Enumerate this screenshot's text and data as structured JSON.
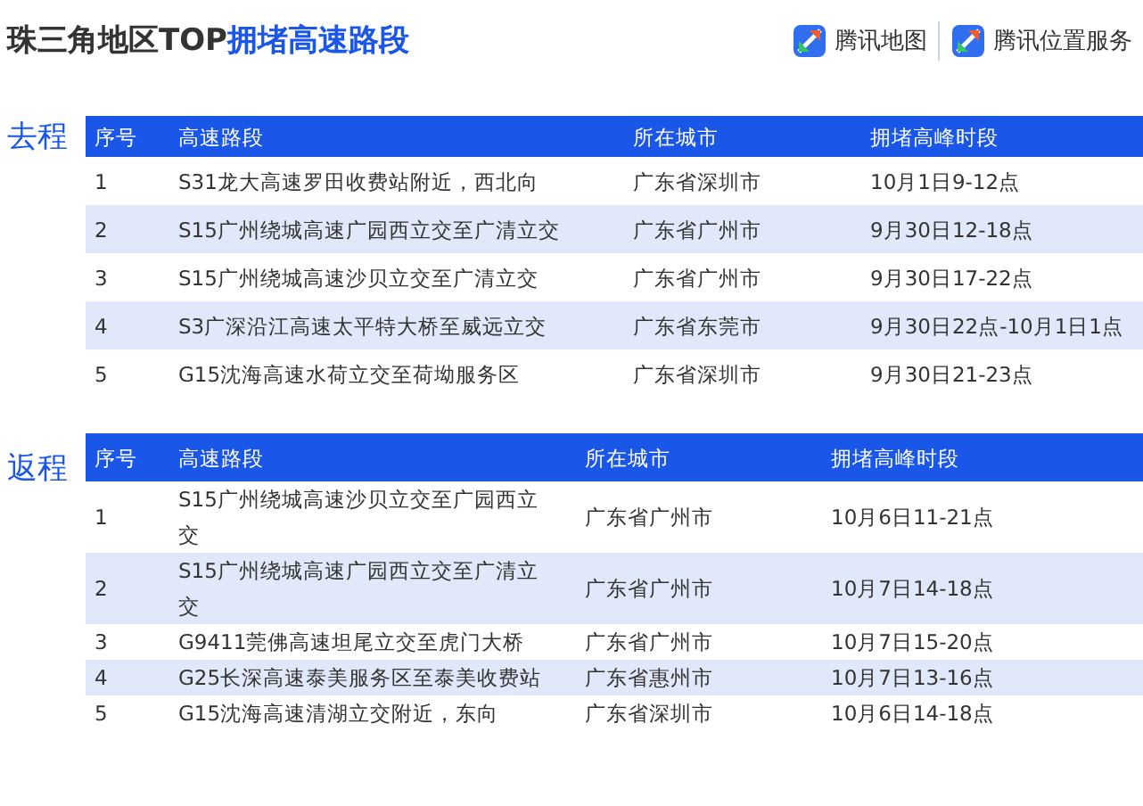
{
  "title": {
    "plain": "珠三角地区TOP",
    "highlight": "拥堵高速路段"
  },
  "brands": [
    {
      "name": "腾讯地图"
    },
    {
      "name": "腾讯位置服务"
    }
  ],
  "sections": [
    {
      "label": "去程",
      "columns": [
        "序号",
        "高速路段",
        "所在城市",
        "拥堵高峰时段"
      ],
      "rows": [
        [
          "1",
          "S31龙大高速罗田收费站附近，西北向",
          "广东省深圳市",
          "10月1日9-12点"
        ],
        [
          "2",
          "S15广州绕城高速广园西立交至广清立交",
          "广东省广州市",
          "9月30日12-18点"
        ],
        [
          "3",
          "S15广州绕城高速沙贝立交至广清立交",
          "广东省广州市",
          "9月30日17-22点"
        ],
        [
          "4",
          "S3广深沿江高速太平特大桥至威远立交",
          "广东省东莞市",
          "9月30日22点-10月1日1点"
        ],
        [
          "5",
          "G15沈海高速水荷立交至荷坳服务区",
          "广东省深圳市",
          "9月30日21-23点"
        ]
      ]
    },
    {
      "label": "返程",
      "columns": [
        "序号",
        "高速路段",
        "所在城市",
        "拥堵高峰时段"
      ],
      "rows": [
        [
          "1",
          "S15广州绕城高速沙贝立交至广园西立交",
          "广东省广州市",
          "10月6日11-21点"
        ],
        [
          "2",
          "S15广州绕城高速广园西立交至广清立交",
          "广东省广州市",
          "10月7日14-18点"
        ],
        [
          "3",
          "G9411莞佛高速坦尾立交至虎门大桥",
          "广东省广州市",
          "10月7日15-20点"
        ],
        [
          "4",
          "G25长深高速泰美服务区至泰美收费站",
          "广东省惠州市",
          "10月7日13-16点"
        ],
        [
          "5",
          "G15沈海高速清湖立交附近，东向",
          "广东省深圳市",
          "10月6日14-18点"
        ]
      ]
    }
  ]
}
